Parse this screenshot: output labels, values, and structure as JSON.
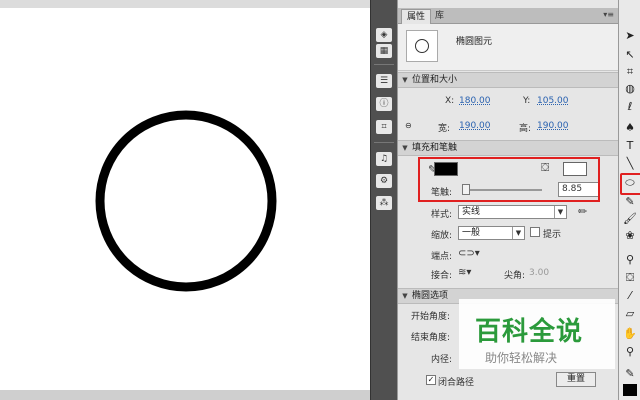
{
  "panel": {
    "tab_properties": "属性",
    "tab_library": "库",
    "menu_glyph": "▾≡",
    "shape_name": "椭圆图元"
  },
  "position_size": {
    "title": "位置和大小",
    "x_label": "X:",
    "x_value": "180.00",
    "y_label": "Y:",
    "y_value": "105.00",
    "width_label": "宽:",
    "width_value": "190.00",
    "height_label": "高:",
    "height_value": "190.00"
  },
  "fill_stroke": {
    "title": "填充和笔触",
    "stroke_color": "#000000",
    "fill_color": "#ffffff",
    "stroke_label": "笔触:",
    "stroke_value": "8.85",
    "style_label": "样式:",
    "style_value": "实线",
    "scale_label": "缩放:",
    "scale_value": "一般",
    "hint_label": "提示",
    "cap_label": "端点:",
    "join_label": "接合:",
    "miter_label": "尖角:",
    "miter_value": "3.00"
  },
  "oval_options": {
    "title": "椭圆选项",
    "start_angle_label": "开始角度:",
    "end_angle_label": "结束角度:",
    "inner_radius_label": "内径:",
    "close_path_label": "闭合路径",
    "reset_label": "重置"
  },
  "watermark": {
    "title": "百科全说",
    "subtitle": "助你轻松解决"
  },
  "colors": {
    "highlight_red": "#e02020",
    "link_blue": "#2a62b0",
    "watermark_green": "#2b9a3b"
  }
}
